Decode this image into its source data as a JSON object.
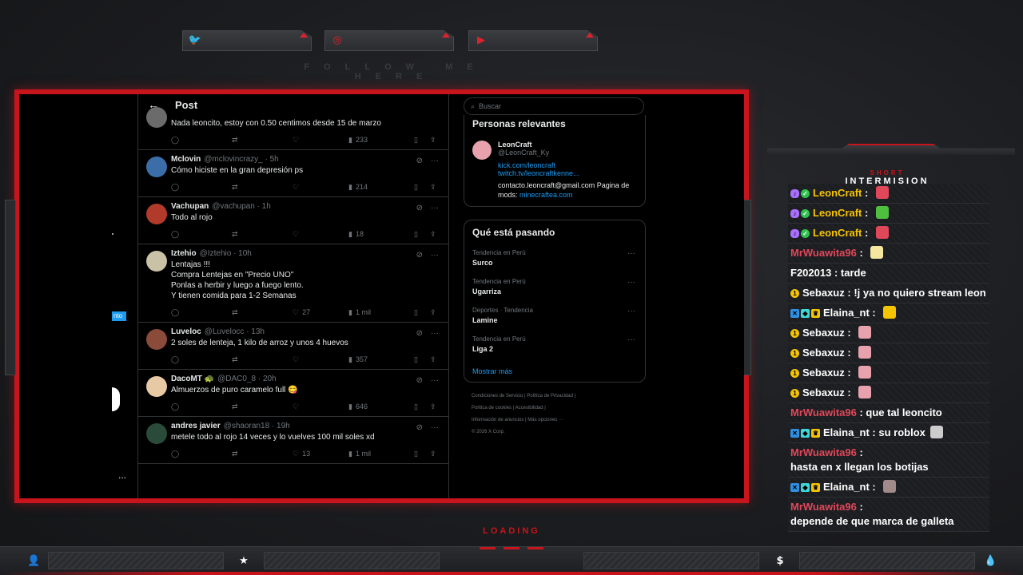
{
  "overlay": {
    "follow_text": "FOLLOW ME HERE",
    "loading_text": "LOADING",
    "chat_title_small": "SHORT",
    "chat_title_big": "INTERMISION",
    "accent_color": "#c8141c",
    "socials": [
      {
        "icon": "twitter-icon",
        "glyph": "🐦"
      },
      {
        "icon": "instagram-icon",
        "glyph": "◎"
      },
      {
        "icon": "youtube-icon",
        "glyph": "▶"
      }
    ],
    "bottom_icons": [
      {
        "icon": "user-icon",
        "glyph": "👤"
      },
      {
        "icon": "star-icon",
        "glyph": "★"
      },
      {
        "icon": "dollar-icon",
        "glyph": "$"
      },
      {
        "icon": "drop-icon",
        "glyph": "💧"
      }
    ]
  },
  "left_nav": {
    "badge_text": "nto",
    "more_label": "..."
  },
  "post": {
    "back_label": "←",
    "title": "Post",
    "tweets": [
      {
        "name": "",
        "handle": "",
        "time": "",
        "text": "Nada leoncito, estoy con 0.50 centimos desde 15 de marzo",
        "likes": "",
        "views": "233",
        "avatar_color": "#6b6b6b"
      },
      {
        "name": "Mclovin",
        "handle": "@mclovincrazy_ · 5h",
        "time": "",
        "text": "Cómo hiciste en la gran depresión ps",
        "likes": "",
        "views": "214",
        "avatar_color": "#3b6ea8"
      },
      {
        "name": "Vachupan",
        "handle": "@vachupan · 1h",
        "time": "",
        "text": "Todo al rojo",
        "likes": "",
        "views": "18",
        "avatar_color": "#b23a2a"
      },
      {
        "name": "Iztehio",
        "handle": "@Iztehio · 10h",
        "time": "",
        "text": "Lentajas !!!\nCompra Lentejas en \"Precio UNO\"\nPonlas a herbir y luego a fuego lento.\nY tienen comida para 1-2 Semanas",
        "likes": "27",
        "views": "1 mil",
        "avatar_color": "#c9c2a6"
      },
      {
        "name": "Luveloc",
        "handle": "@Luvelocc · 13h",
        "time": "",
        "text": "2 soles de lenteja, 1 kilo de arroz y unos 4 huevos",
        "likes": "",
        "views": "357",
        "avatar_color": "#8a4b3a"
      },
      {
        "name": "DacoMT 🐢",
        "handle": "@DAC0_8 · 20h",
        "time": "",
        "text": "Almuerzos de puro caramelo full 😋",
        "likes": "",
        "views": "646",
        "avatar_color": "#e8c9a6"
      },
      {
        "name": "andres javier",
        "handle": "@shaoran18 · 19h",
        "time": "",
        "text": "metele todo al rojo 14 veces y lo  vuelves 100 mil soles  xd",
        "likes": "13",
        "views": "1 mil",
        "avatar_color": "#2a4a3a"
      }
    ]
  },
  "sidebar": {
    "search_placeholder": "Buscar",
    "relevant_title": "Personas relevantes",
    "relevant": {
      "name": "LeonCraft",
      "handle": "@LeonCraft_Ky",
      "link1": "kick.com/leoncraft",
      "link2": "twitch.tv/leoncraftkenne...",
      "bio": "contacto.leoncraft@gmail.com Pagina de mods:",
      "bio_link": "minecraftea.com"
    },
    "trends_title": "Qué está pasando",
    "trends": [
      {
        "meta": "Tendencia en Perú",
        "topic": "Surco"
      },
      {
        "meta": "Tendencia en Perú",
        "topic": "Ugarriza"
      },
      {
        "meta": "Deportes · Tendencia",
        "topic": "Lamine"
      },
      {
        "meta": "Tendencia en Perú",
        "topic": "Liga 2"
      }
    ],
    "show_more": "Mostrar más",
    "footer": {
      "l1": "Condiciones de Servicio  |  Política de Privacidad  |",
      "l2": "Política de cookies  |  Accesibilidad  |",
      "l3": "Información de anuncios  |  Más opciones ···",
      "l4": "© 2026 X Corp."
    }
  },
  "chat": {
    "messages": [
      {
        "user": "LeonCraft",
        "text": "",
        "color": "gold",
        "badges": [
          "mic",
          "ok"
        ],
        "emote": "#e0485a"
      },
      {
        "user": "LeonCraft",
        "text": "",
        "color": "gold",
        "badges": [
          "mic",
          "ok"
        ],
        "emote": "#4fbf3f"
      },
      {
        "user": "LeonCraft",
        "text": "",
        "color": "gold",
        "badges": [
          "mic",
          "ok"
        ],
        "emote": "#e0485a"
      },
      {
        "user": "MrWuawita96",
        "text": "",
        "color": "pink",
        "badges": [],
        "emote": "#f5e6a0"
      },
      {
        "user": "F202013",
        "text": "tarde",
        "color": "white",
        "badges": [],
        "emote": ""
      },
      {
        "user": "Sebaxuz",
        "text": "!j ya no quiero stream leon",
        "color": "white",
        "badges": [
          "one"
        ],
        "emote": ""
      },
      {
        "user": "Elaina_nt",
        "text": "",
        "color": "white",
        "badges": [
          "blue",
          "cyan",
          "crown"
        ],
        "emote": "#f5c400"
      },
      {
        "user": "Sebaxuz",
        "text": "",
        "color": "white",
        "badges": [
          "one"
        ],
        "emote": "#e8a2ae"
      },
      {
        "user": "Sebaxuz",
        "text": "",
        "color": "white",
        "badges": [
          "one"
        ],
        "emote": "#e8a2ae"
      },
      {
        "user": "Sebaxuz",
        "text": "",
        "color": "white",
        "badges": [
          "one"
        ],
        "emote": "#e8a2ae"
      },
      {
        "user": "Sebaxuz",
        "text": "",
        "color": "white",
        "badges": [
          "one"
        ],
        "emote": "#e8a2ae"
      },
      {
        "user": "MrWuawita96",
        "text": "que tal leoncito",
        "color": "pink",
        "badges": [],
        "emote": ""
      },
      {
        "user": "Elaina_nt",
        "text": "su roblox",
        "color": "white",
        "badges": [
          "blue",
          "cyan",
          "crown"
        ],
        "emote": "#cccccc"
      },
      {
        "user": "MrWuawita96",
        "text": "hasta en x llegan los botijas",
        "color": "pink",
        "badges": [],
        "emote": ""
      },
      {
        "user": "Elaina_nt",
        "text": "",
        "color": "white",
        "badges": [
          "blue",
          "cyan",
          "crown"
        ],
        "emote": "#a08a8a"
      },
      {
        "user": "MrWuawita96",
        "text": "depende de que marca de galleta",
        "color": "pink",
        "badges": [],
        "emote": ""
      }
    ]
  }
}
